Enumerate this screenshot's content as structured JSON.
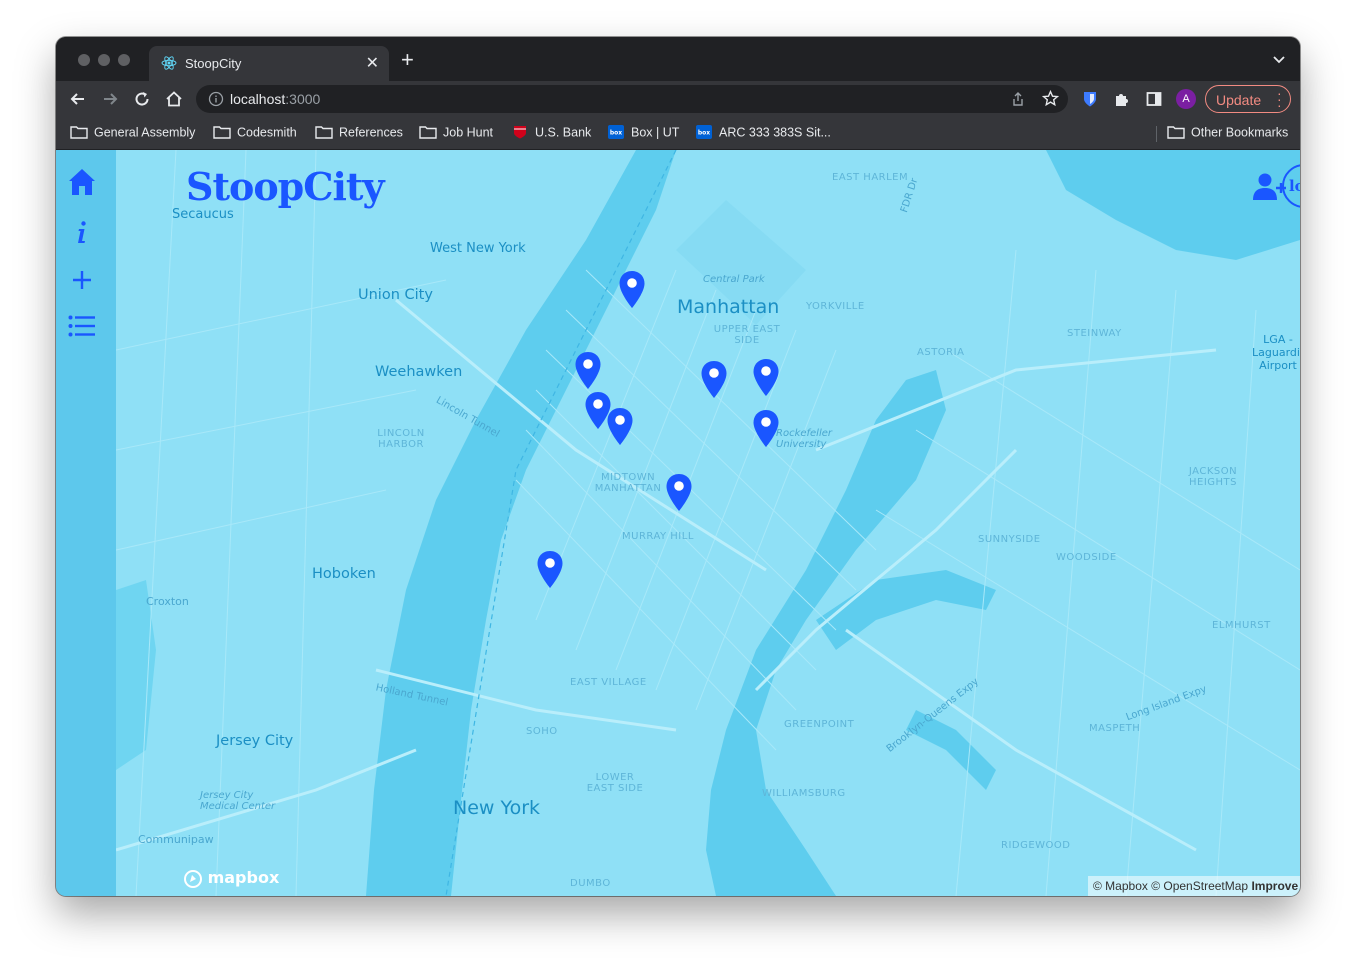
{
  "browser": {
    "tab_title": "StoopCity",
    "url_host": "localhost",
    "url_port": ":3000",
    "update_label": "Update",
    "avatar_letter": "A",
    "bookmarks": [
      {
        "label": "General Assembly",
        "icon": "folder-icon"
      },
      {
        "label": "Codesmith",
        "icon": "folder-icon"
      },
      {
        "label": "References",
        "icon": "folder-icon"
      },
      {
        "label": "Job Hunt",
        "icon": "folder-icon"
      },
      {
        "label": "U.S. Bank",
        "icon": "usbank-shield-icon"
      },
      {
        "label": "Box | UT",
        "icon": "box-icon"
      },
      {
        "label": "ARC 333 383S Sit...",
        "icon": "box-icon"
      }
    ],
    "other_bookmarks": "Other Bookmarks"
  },
  "app": {
    "logo": "StoopCity",
    "login_label": "log in",
    "sidebar": [
      "home-icon",
      "info-icon",
      "add-icon",
      "list-icon"
    ]
  },
  "map": {
    "labels": {
      "manhattan": "Manhattan",
      "new_york": "New York",
      "union_city": "Union City",
      "weehawken": "Weehawken",
      "hoboken": "Hoboken",
      "jersey_city": "Jersey City",
      "west_new_york": "West New York",
      "secaucus": "Secaucus",
      "central_park": "Central Park",
      "upper_east_side": "UPPER EAST SIDE",
      "midtown": "MIDTOWN MANHATTAN",
      "murray_hill": "MURRAY HILL",
      "east_village": "EAST VILLAGE",
      "soho": "SOHO",
      "lower_east_side": "LOWER EAST SIDE",
      "east_harlem": "EAST HARLEM",
      "yorkville": "YORKVILLE",
      "astoria": "ASTORIA",
      "steinway": "STEINWAY",
      "sunnyside": "SUNNYSIDE",
      "woodside": "WOODSIDE",
      "jackson_heights": "JACKSON HEIGHTS",
      "elmhurst": "ELMHURST",
      "maspeth": "MASPETH",
      "greenpoint": "GREENPOINT",
      "williamsburg": "WILLIAMSBURG",
      "ridgewood": "RIDGEWOOD",
      "dumbo": "DUMBO",
      "lga": "LGA - Laguardia Airport",
      "lincoln_harbor": "LINCOLN HARBOR",
      "rockefeller": "Rockefeller University",
      "croxton": "Croxton",
      "communipaw": "Communipaw",
      "jc_medical": "Jersey City Medical Center",
      "holland_tunnel": "Holland Tunnel",
      "lincoln_tunnel": "Lincoln Tunnel",
      "long_island_expy": "Long Island Expy",
      "bqe": "Brooklyn-Queens Expy",
      "fdr": "FDR Dr"
    },
    "marker_count": 10,
    "zoom_in": "+",
    "zoom_out": "−",
    "compass": "▲",
    "mapbox_logo": "mapbox",
    "attribution": "© Mapbox © OpenStreetMap",
    "improve": "Improve this map",
    "colors": {
      "water": "#5ecdee",
      "land": "#8fe0f6",
      "marker": "#1a56ff",
      "accent": "#1a56ff"
    }
  }
}
